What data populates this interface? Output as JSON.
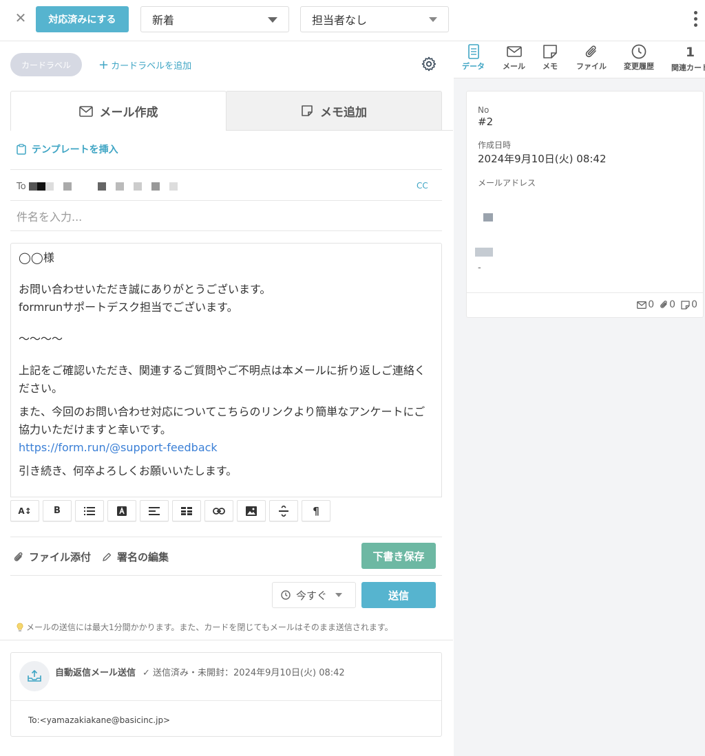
{
  "topbar": {
    "resolve_label": "対応済みにする",
    "status_value": "新着",
    "assignee_value": "担当者なし"
  },
  "labels": {
    "chip_label": "カードラベル",
    "add_label": "カードラベルを追加"
  },
  "compose_tabs": {
    "mail_label": "メール作成",
    "memo_label": "メモ追加"
  },
  "compose": {
    "template_label": "テンプレートを挿入",
    "to_label": "To",
    "cc_label": "CC",
    "subject_placeholder": "件名を入力...",
    "body": {
      "line1": "◯◯様",
      "line2": "お問い合わせいただき誠にありがとうございます。",
      "line3": "formrunサポートデスク担当でございます。",
      "line4": "〜〜〜〜",
      "line5": "上記をご確認いただき、関連するご質問やご不明点は本メールに折り返しご連絡ください。",
      "line6": "また、今回のお問い合わせ対応についてこちらのリンクより簡単なアンケートにご協力いただけますと幸いです。",
      "link": "https://form.run/@support-feedback",
      "line7": "引き続き、何卒よろしくお願いいたします。"
    },
    "attach_label": "ファイル添付",
    "signature_label": "署名の編集",
    "draft_label": "下書き保存",
    "schedule_value": "今すぐ",
    "send_label": "送信",
    "note": "メールの送信には最大1分間かかります。また、カードを閉じてもメールはそのまま送信されます。"
  },
  "history": {
    "title": "自動返信メール送信",
    "status": "✓ 送信済み・未開封：2024年9月10日(火) 08:42",
    "to": "To:<yamazakiakane@basicinc.jp>"
  },
  "right_tabs": {
    "data": "データ",
    "mail": "メール",
    "memo": "メモ",
    "file": "ファイル",
    "history": "変更履歴",
    "related_count": "1",
    "related": "関連カード"
  },
  "card": {
    "no_label": "No",
    "no_value": "#2",
    "created_label": "作成日時",
    "created_value": "2024年9月10日(火) 08:42",
    "email_label": "メールアドレス",
    "dash": "-",
    "mail_count": "0",
    "file_count": "0",
    "memo_count": "0"
  },
  "colors": {
    "accent": "#56b4cf",
    "link": "#3fa5c4",
    "draft": "#6db8a3"
  }
}
